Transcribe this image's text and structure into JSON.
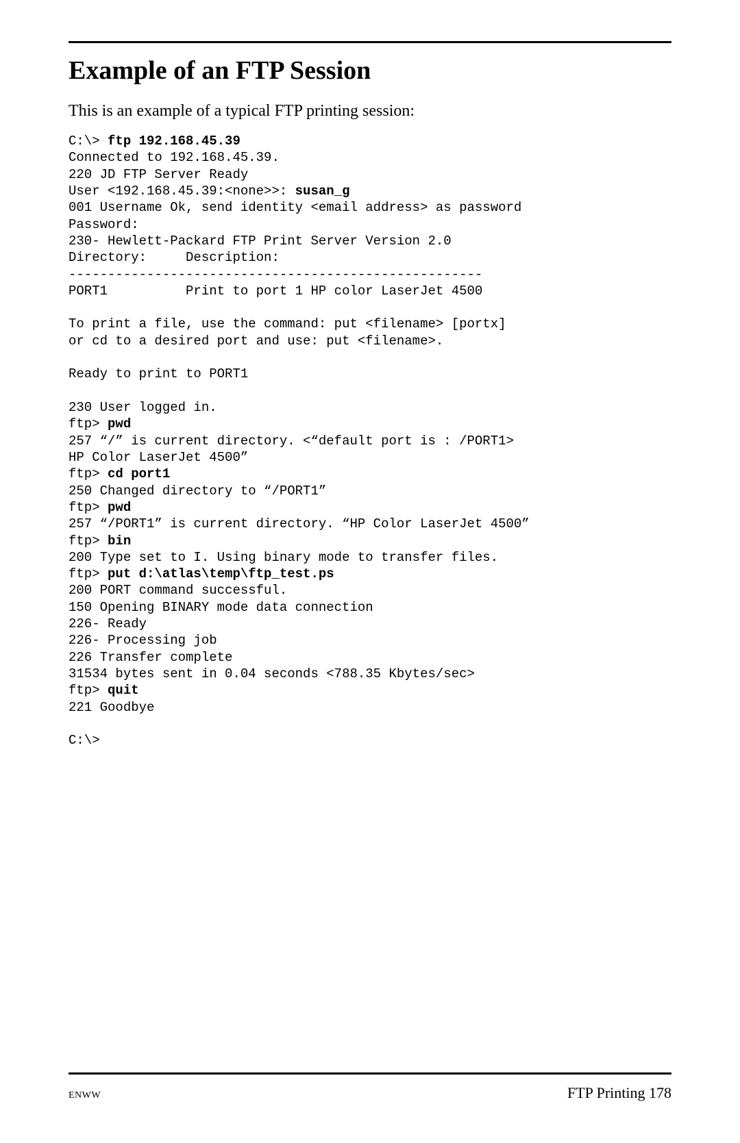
{
  "header": {
    "title": "Example of an FTP Session"
  },
  "intro": "This is an example of a typical FTP printing session:",
  "session": [
    {
      "t": "C:\\> ",
      "b": "ftp 192.168.45.39"
    },
    {
      "t": "Connected to 192.168.45.39."
    },
    {
      "t": "220 JD FTP Server Ready"
    },
    {
      "t": "User <192.168.45.39:<none>>: ",
      "b": "susan_g"
    },
    {
      "t": "001 Username Ok, send identity <email address> as password"
    },
    {
      "t": "Password:"
    },
    {
      "t": "230- Hewlett-Packard FTP Print Server Version 2.0"
    },
    {
      "t": "Directory:     Description:"
    },
    {
      "t": "-----------------------------------------------------"
    },
    {
      "t": "PORT1          Print to port 1 HP color LaserJet 4500"
    },
    {
      "t": ""
    },
    {
      "t": "To print a file, use the command: put <filename> [portx]"
    },
    {
      "t": "or cd to a desired port and use: put <filename>."
    },
    {
      "t": ""
    },
    {
      "t": "Ready to print to PORT1"
    },
    {
      "t": ""
    },
    {
      "t": "230 User logged in."
    },
    {
      "t": "ftp> ",
      "b": "pwd"
    },
    {
      "t": "257 “/” is current directory. <“default port is : /PORT1>"
    },
    {
      "t": "HP Color LaserJet 4500”"
    },
    {
      "t": "ftp> ",
      "b": "cd port1"
    },
    {
      "t": "250 Changed directory to “/PORT1”"
    },
    {
      "t": "ftp> ",
      "b": "pwd"
    },
    {
      "t": "257 “/PORT1” is current directory. “HP Color LaserJet 4500”"
    },
    {
      "t": "ftp> ",
      "b": "bin"
    },
    {
      "t": "200 Type set to I. Using binary mode to transfer files."
    },
    {
      "t": "ftp> ",
      "b": "put d:\\atlas\\temp\\ftp_test.ps"
    },
    {
      "t": "200 PORT command successful."
    },
    {
      "t": "150 Opening BINARY mode data connection"
    },
    {
      "t": "226- Ready"
    },
    {
      "t": "226- Processing job"
    },
    {
      "t": "226 Transfer complete"
    },
    {
      "t": "31534 bytes sent in 0.04 seconds <788.35 Kbytes/sec>"
    },
    {
      "t": "ftp> ",
      "b": "quit"
    },
    {
      "t": "221 Goodbye"
    },
    {
      "t": ""
    },
    {
      "t": "C:\\>"
    }
  ],
  "footer": {
    "left": "ENWW",
    "right_text": "FTP Printing",
    "page_number": "178"
  }
}
